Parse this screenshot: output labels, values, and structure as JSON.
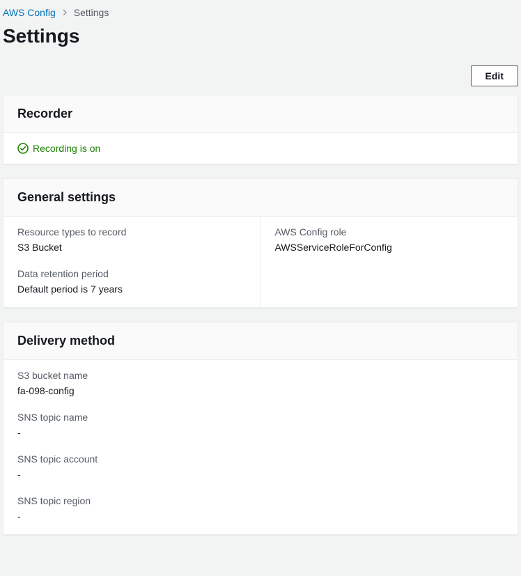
{
  "breadcrumb": {
    "root": "AWS Config",
    "current": "Settings"
  },
  "page": {
    "title": "Settings"
  },
  "actions": {
    "edit": "Edit"
  },
  "recorder": {
    "heading": "Recorder",
    "status_text": "Recording is on"
  },
  "general": {
    "heading": "General settings",
    "resource_types_label": "Resource types to record",
    "resource_types_value": "S3 Bucket",
    "retention_label": "Data retention period",
    "retention_value": "Default period is 7 years",
    "role_label": "AWS Config role",
    "role_value": "AWSServiceRoleForConfig"
  },
  "delivery": {
    "heading": "Delivery method",
    "s3_label": "S3 bucket name",
    "s3_value": "fa-098-config",
    "sns_name_label": "SNS topic name",
    "sns_name_value": "-",
    "sns_account_label": "SNS topic account",
    "sns_account_value": "-",
    "sns_region_label": "SNS topic region",
    "sns_region_value": "-"
  }
}
